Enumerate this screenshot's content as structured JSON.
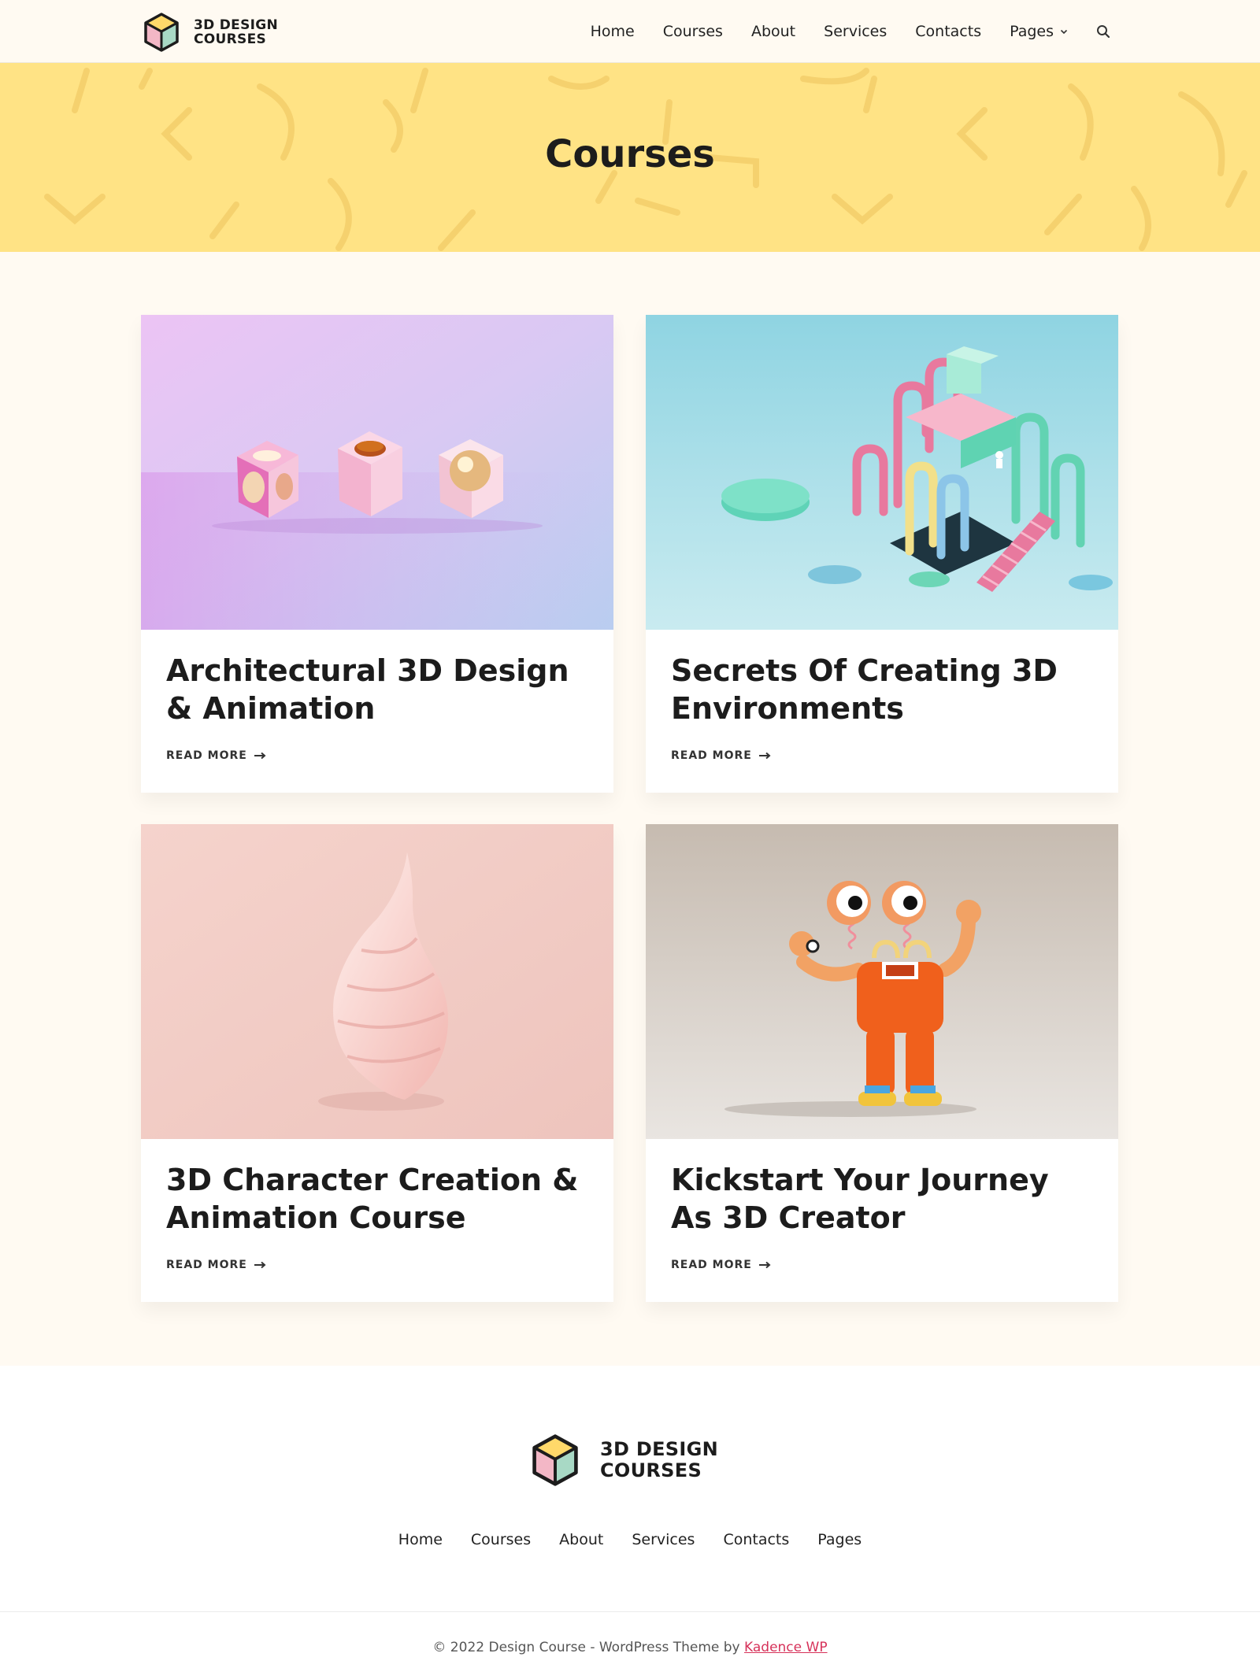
{
  "header": {
    "logo_line1": "3D DESIGN",
    "logo_line2": "COURSES",
    "nav": [
      "Home",
      "Courses",
      "About",
      "Services",
      "Contacts",
      "Pages"
    ]
  },
  "hero": {
    "title": "Courses"
  },
  "courses": [
    {
      "title": "Architectural 3D Design & Animation",
      "link": "READ MORE"
    },
    {
      "title": "Secrets Of Creating 3D Environments",
      "link": "READ MORE"
    },
    {
      "title": "3D Character Creation & Animation Course",
      "link": "READ MORE"
    },
    {
      "title": "Kickstart Your Journey As 3D Creator",
      "link": "READ MORE"
    }
  ],
  "footer": {
    "logo_line1": "3D DESIGN",
    "logo_line2": "COURSES",
    "nav": [
      "Home",
      "Courses",
      "About",
      "Services",
      "Contacts",
      "Pages"
    ],
    "copyright": "© 2022 Design Course - WordPress Theme by ",
    "credit_link": "Kadence WP"
  },
  "icons": {
    "logo": "cube-logo-icon",
    "search": "search-icon",
    "chevron": "chevron-down-icon",
    "arrow": "arrow-right-icon"
  },
  "colors": {
    "background": "#fffaf2",
    "hero": "#ffe385",
    "link_accent": "#d6325a",
    "text": "#1c1c1c"
  }
}
